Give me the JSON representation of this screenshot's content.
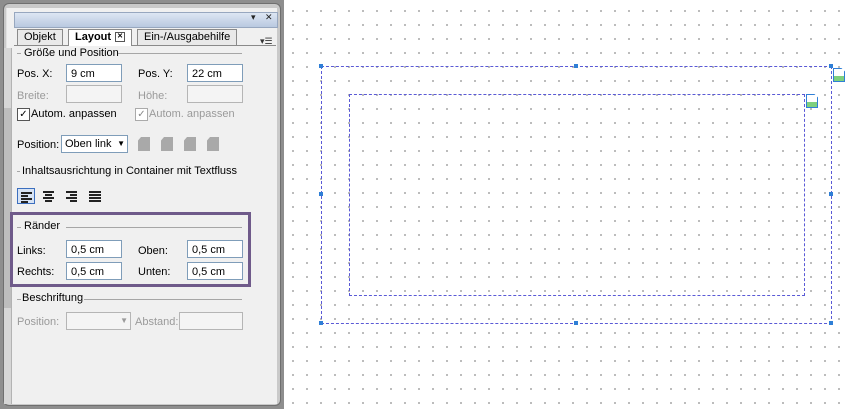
{
  "panel": {
    "tabs": [
      {
        "label": "Objekt"
      },
      {
        "label": "Layout",
        "close": "✕"
      },
      {
        "label": "Ein-/Ausgabehilfe"
      }
    ],
    "titlebar": {
      "dropdown_glyph": "▾",
      "close_glyph": "✕"
    },
    "menu_glyph": "▾☰",
    "size_position": {
      "title": "Größe und Position",
      "pos_x_label": "Pos. X:",
      "pos_x_value": "9 cm",
      "pos_y_label": "Pos. Y:",
      "pos_y_value": "22 cm",
      "width_label": "Breite:",
      "width_value": "",
      "height_label": "Höhe:",
      "height_value": "",
      "autofit_label": "Autom. anpassen",
      "autofit2_label": "Autom. anpassen",
      "check_glyph": "✓"
    },
    "position": {
      "label": "Position:",
      "value": "Oben link",
      "arrow": "▼"
    },
    "alignment": {
      "title": "Inhaltsausrichtung in Container mit Textfluss"
    },
    "margins": {
      "title": "Ränder",
      "left_label": "Links:",
      "left_value": "0,5 cm",
      "top_label": "Oben:",
      "top_value": "0,5 cm",
      "right_label": "Rechts:",
      "right_value": "0,5 cm",
      "bottom_label": "Unten:",
      "bottom_value": "0,5 cm"
    },
    "caption": {
      "title": "Beschriftung",
      "position_label": "Position:",
      "position_value": "",
      "arrow": "▼",
      "distance_label": "Abstand:",
      "distance_value": ""
    }
  },
  "colors": {
    "highlight": "#6f5a8a",
    "frame": "#5a5ad6",
    "handle": "#2f7fd6"
  },
  "icons": {
    "panel": [
      "doc-align-top-left-icon",
      "doc-align-top-right-icon",
      "doc-align-bottom-left-icon",
      "doc-align-bottom-right-icon",
      "align-left-icon",
      "align-center-icon",
      "align-right-icon",
      "align-justify-icon"
    ],
    "canvas": [
      "outer-frame-doc-icon",
      "inner-frame-doc-icon"
    ]
  }
}
